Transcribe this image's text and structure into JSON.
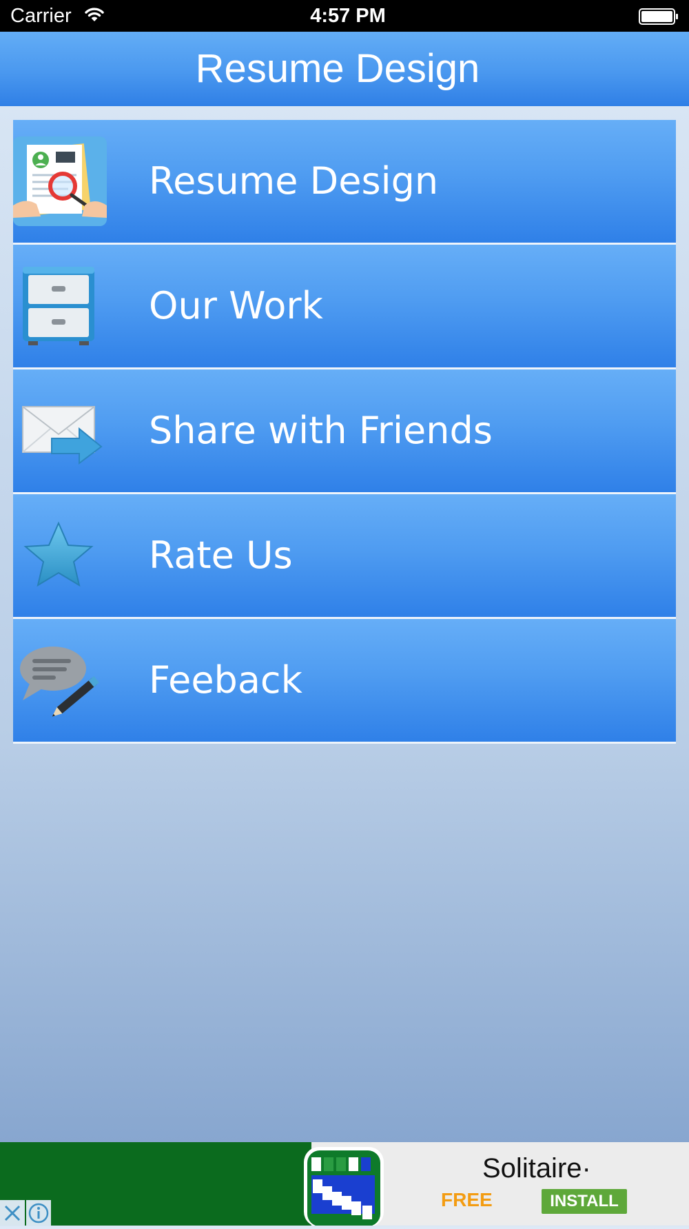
{
  "status_bar": {
    "carrier": "Carrier",
    "time": "4:57 PM",
    "icons": [
      "wifi-icon",
      "battery-icon"
    ]
  },
  "nav": {
    "title": "Resume Design"
  },
  "menu": {
    "items": [
      {
        "label": "Resume Design",
        "icon": "cv-magnifier-icon"
      },
      {
        "label": "Our Work",
        "icon": "file-cabinet-icon"
      },
      {
        "label": "Share with Friends",
        "icon": "envelope-arrow-icon"
      },
      {
        "label": "Rate Us",
        "icon": "star-icon"
      },
      {
        "label": "Feeback",
        "icon": "speech-bubble-pencil-icon"
      }
    ]
  },
  "ad": {
    "title": "Solitaire·",
    "price": "FREE",
    "install_label": "INSTALL",
    "icons": [
      "ad-close-icon",
      "ad-info-icon",
      "solitaire-app-icon"
    ]
  },
  "colors": {
    "nav_bar": "#4a98ef",
    "menu_item": "#4f9cf1",
    "ad_green": "#0b6b1e",
    "ad_free": "#f39c12",
    "ad_install": "#5ea83a"
  }
}
